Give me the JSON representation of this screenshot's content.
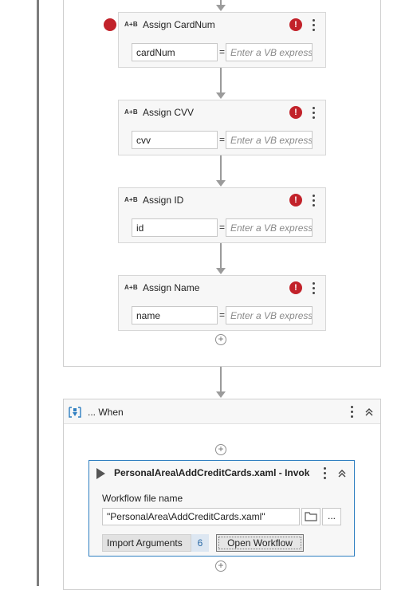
{
  "activities": [
    {
      "ab_icon": "A+B",
      "title": "Assign CardNum",
      "left_value": "cardNum",
      "right_placeholder": "Enter a VB expression",
      "has_breakpoint": true,
      "error_icon": "!"
    },
    {
      "ab_icon": "A+B",
      "title": "Assign CVV",
      "left_value": "cvv",
      "right_placeholder": "Enter a VB expression",
      "has_breakpoint": false,
      "error_icon": "!"
    },
    {
      "ab_icon": "A+B",
      "title": "Assign ID",
      "left_value": "id",
      "right_placeholder": "Enter a VB expression",
      "has_breakpoint": false,
      "error_icon": "!"
    },
    {
      "ab_icon": "A+B",
      "title": "Assign Name",
      "left_value": "name",
      "right_placeholder": "Enter a VB expression",
      "has_breakpoint": false,
      "error_icon": "!"
    }
  ],
  "equals": "=",
  "add_glyph": "+",
  "when": {
    "label": "... When",
    "icon": "when-icon",
    "collapse_glyph": "⌃"
  },
  "invoke": {
    "title": "PersonalArea\\AddCreditCards.xaml - Invoke...",
    "workflow_label": "Workflow file name",
    "workflow_value": "\"PersonalArea\\AddCreditCards.xaml\"",
    "browse_icon": "folder-icon",
    "ellipsis_label": "...",
    "import_label": "Import Arguments",
    "argument_count": "6",
    "open_label": "Open Workflow"
  },
  "colors": {
    "error": "#c2222a",
    "selection_border": "#2f7fc1",
    "connector": "#9b9b9b"
  }
}
